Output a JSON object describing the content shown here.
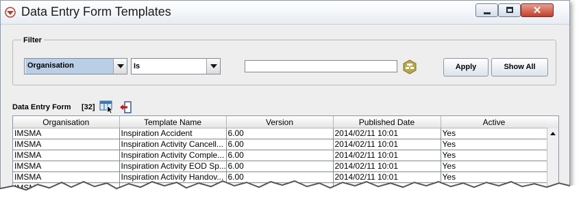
{
  "window": {
    "title": "Data Entry Form Templates"
  },
  "filter": {
    "legend": "Filter",
    "field_value": "Organisation",
    "operator_value": "Is",
    "text_value": "",
    "apply_label": "Apply",
    "show_all_label": "Show All"
  },
  "grid": {
    "label": "Data Entry Form",
    "count": "[32]",
    "columns": [
      "Organisation",
      "Template Name",
      "Version",
      "Published Date",
      "Active"
    ],
    "rows": [
      [
        "IMSMA",
        "Inspiration Accident",
        "6.00",
        "2014/02/11 10:01",
        "Yes"
      ],
      [
        "IMSMA",
        "Inspiration Activity Cancell...",
        "6.00",
        "2014/02/11 10:01",
        "Yes"
      ],
      [
        "IMSMA",
        "Inspiration Activity Comple...",
        "6.00",
        "2014/02/11 10:01",
        "Yes"
      ],
      [
        "IMSMA",
        "Inspiration Activity EOD Sp...",
        "6.00",
        "2014/02/11 10:01",
        "Yes"
      ],
      [
        "IMSMA",
        "Inspiration Activity Handov...",
        "6.00",
        "2014/02/11 10:01",
        "Yes"
      ],
      [
        "IMSMA",
        "",
        "",
        "",
        "Yes"
      ]
    ]
  },
  "colors": {
    "close_button": "#c2402a",
    "selection": "#b8cfe5"
  },
  "icons": [
    "app-icon",
    "minimize-icon",
    "maximize-icon",
    "close-icon",
    "lookup-icon",
    "columns-icon",
    "export-icon",
    "chevron-down-icon",
    "scroll-up-icon"
  ]
}
